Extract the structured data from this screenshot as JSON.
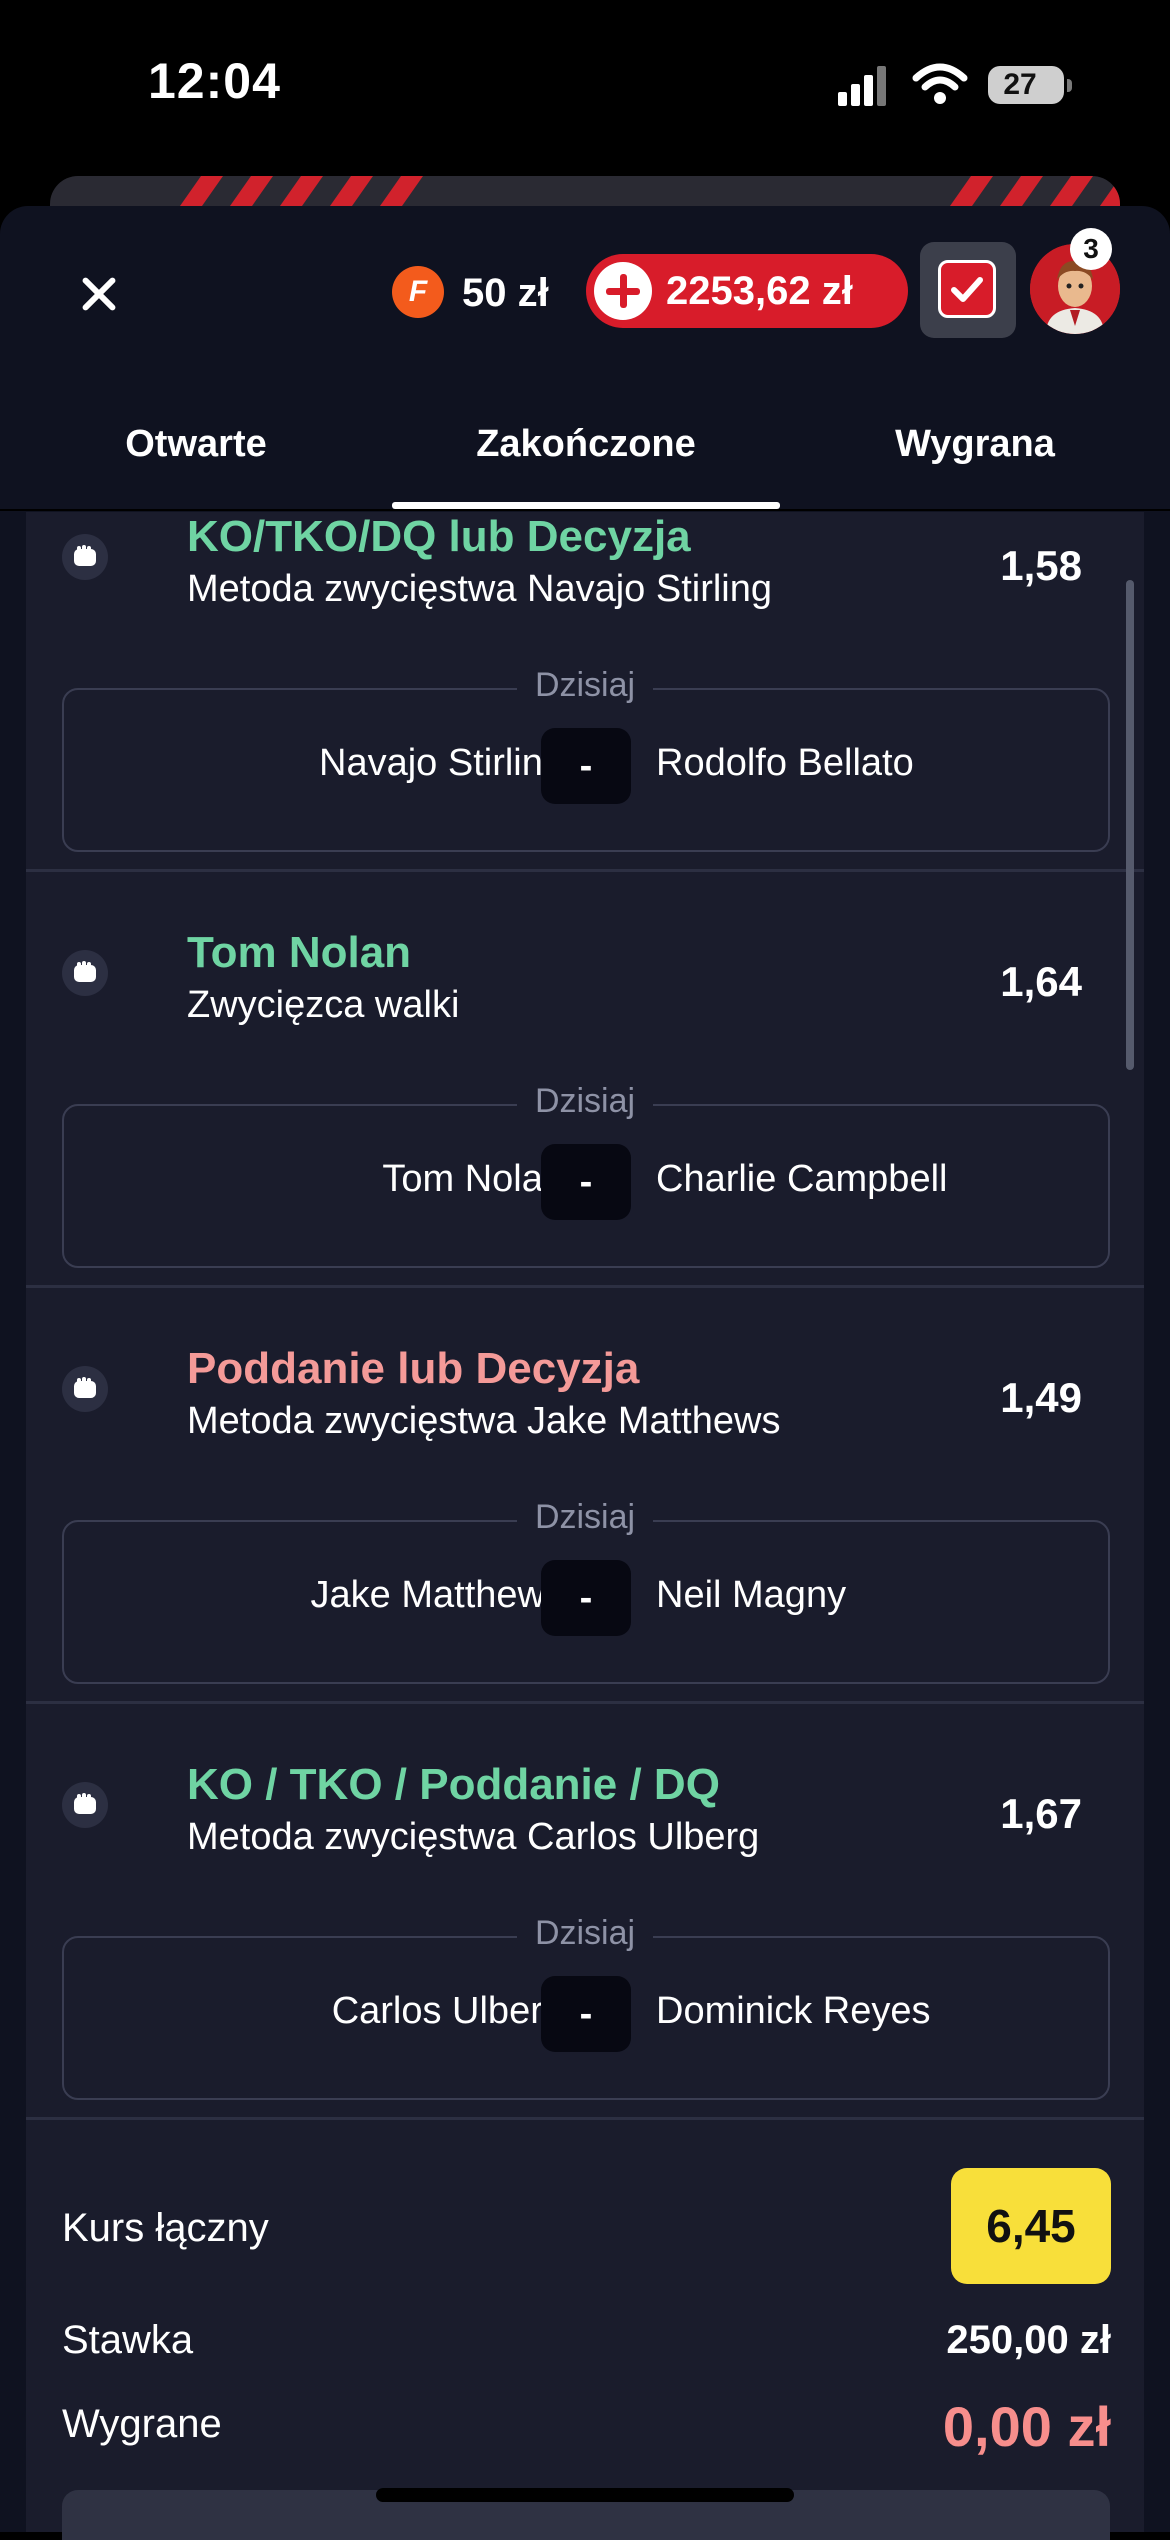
{
  "status": {
    "time": "12:04",
    "battery": "27"
  },
  "header": {
    "coin_letter": "F",
    "coin_value": "50 zł",
    "balance": "2253,62 zł",
    "notifications": "3"
  },
  "tabs": [
    {
      "label": "Otwarte",
      "active": false
    },
    {
      "label": "Zakończone",
      "active": true
    },
    {
      "label": "Wygrana",
      "active": false
    }
  ],
  "bets": [
    {
      "title": "KO/TKO/DQ lub Decyzja",
      "title_color": "#6fd4a3",
      "subtitle": "Metoda zwycięstwa Navajo Stirling",
      "odds": "1,58",
      "date": "Dzisiaj",
      "home": "Navajo Stirling",
      "score": "-",
      "away": "Rodolfo Bellato"
    },
    {
      "title": "Tom Nolan",
      "title_color": "#6fd4a3",
      "subtitle": "Zwycięzca walki",
      "odds": "1,64",
      "date": "Dzisiaj",
      "home": "Tom Nolan",
      "score": "-",
      "away": "Charlie Campbell"
    },
    {
      "title": "Poddanie lub Decyzja",
      "title_color": "#f49a98",
      "subtitle": "Metoda zwycięstwa Jake Matthews",
      "odds": "1,49",
      "date": "Dzisiaj",
      "home": "Jake Matthews",
      "score": "-",
      "away": "Neil Magny"
    },
    {
      "title": "KO / TKO / Poddanie / DQ",
      "title_color": "#6fd4a3",
      "subtitle": "Metoda zwycięstwa Carlos Ulberg",
      "odds": "1,67",
      "date": "Dzisiaj",
      "home": "Carlos Ulberg",
      "score": "-",
      "away": "Dominick Reyes"
    }
  ],
  "summary": {
    "total_odds_label": "Kurs łączny",
    "total_odds": "6,45",
    "stake_label": "Stawka",
    "stake": "250,00 zł",
    "win_label": "Wygrane",
    "win": "0,00 zł"
  },
  "colors": {
    "accent_red": "#d81c2a",
    "win_green": "#6fd4a3",
    "loss_red": "#f49a98",
    "odds_yellow": "#f8df3a"
  }
}
